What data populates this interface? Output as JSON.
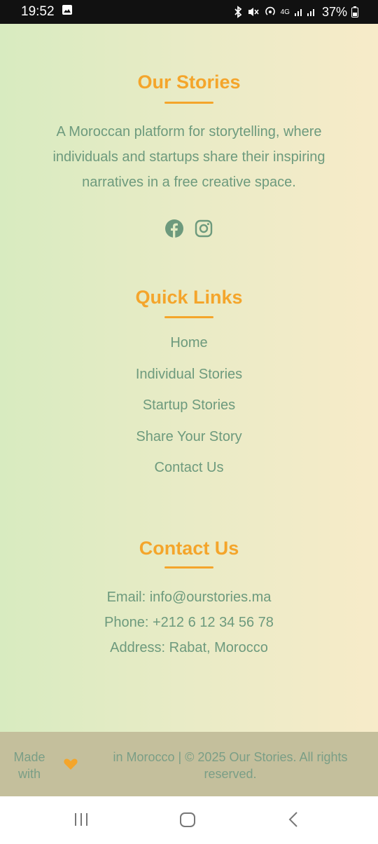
{
  "status_bar": {
    "time": "19:52",
    "battery": "37%",
    "network_label": "4G",
    "icons": [
      "gallery-icon",
      "bluetooth-icon",
      "mute-icon",
      "hotspot-icon",
      "signal-icon",
      "battery-icon"
    ]
  },
  "about": {
    "title": "Our Stories",
    "description": "A Moroccan platform for storytelling, where individuals and startups share their inspiring narratives in a free creative space.",
    "social_icons": [
      "facebook-icon",
      "instagram-icon"
    ]
  },
  "quick_links": {
    "title": "Quick Links",
    "items": [
      "Home",
      "Individual Stories",
      "Startup Stories",
      "Share Your Story",
      "Contact Us"
    ]
  },
  "contact": {
    "title": "Contact Us",
    "email": "Email: info@ourstories.ma",
    "phone": "Phone: +212 6 12 34 56 78",
    "address": "Address: Rabat, Morocco"
  },
  "footer": {
    "made_with": "Made with",
    "copyright": "in Morocco | © 2025 Our Stories. All rights reserved."
  },
  "nav_bar": {
    "buttons": [
      "recent-apps-icon",
      "home-icon",
      "back-icon"
    ]
  },
  "colors": {
    "accent": "#f4a52b",
    "text": "#6d9a7d",
    "gradient_start": "#d8ebc0",
    "gradient_end": "#f7ebc9",
    "footer_bg": "#c4bf9c"
  }
}
